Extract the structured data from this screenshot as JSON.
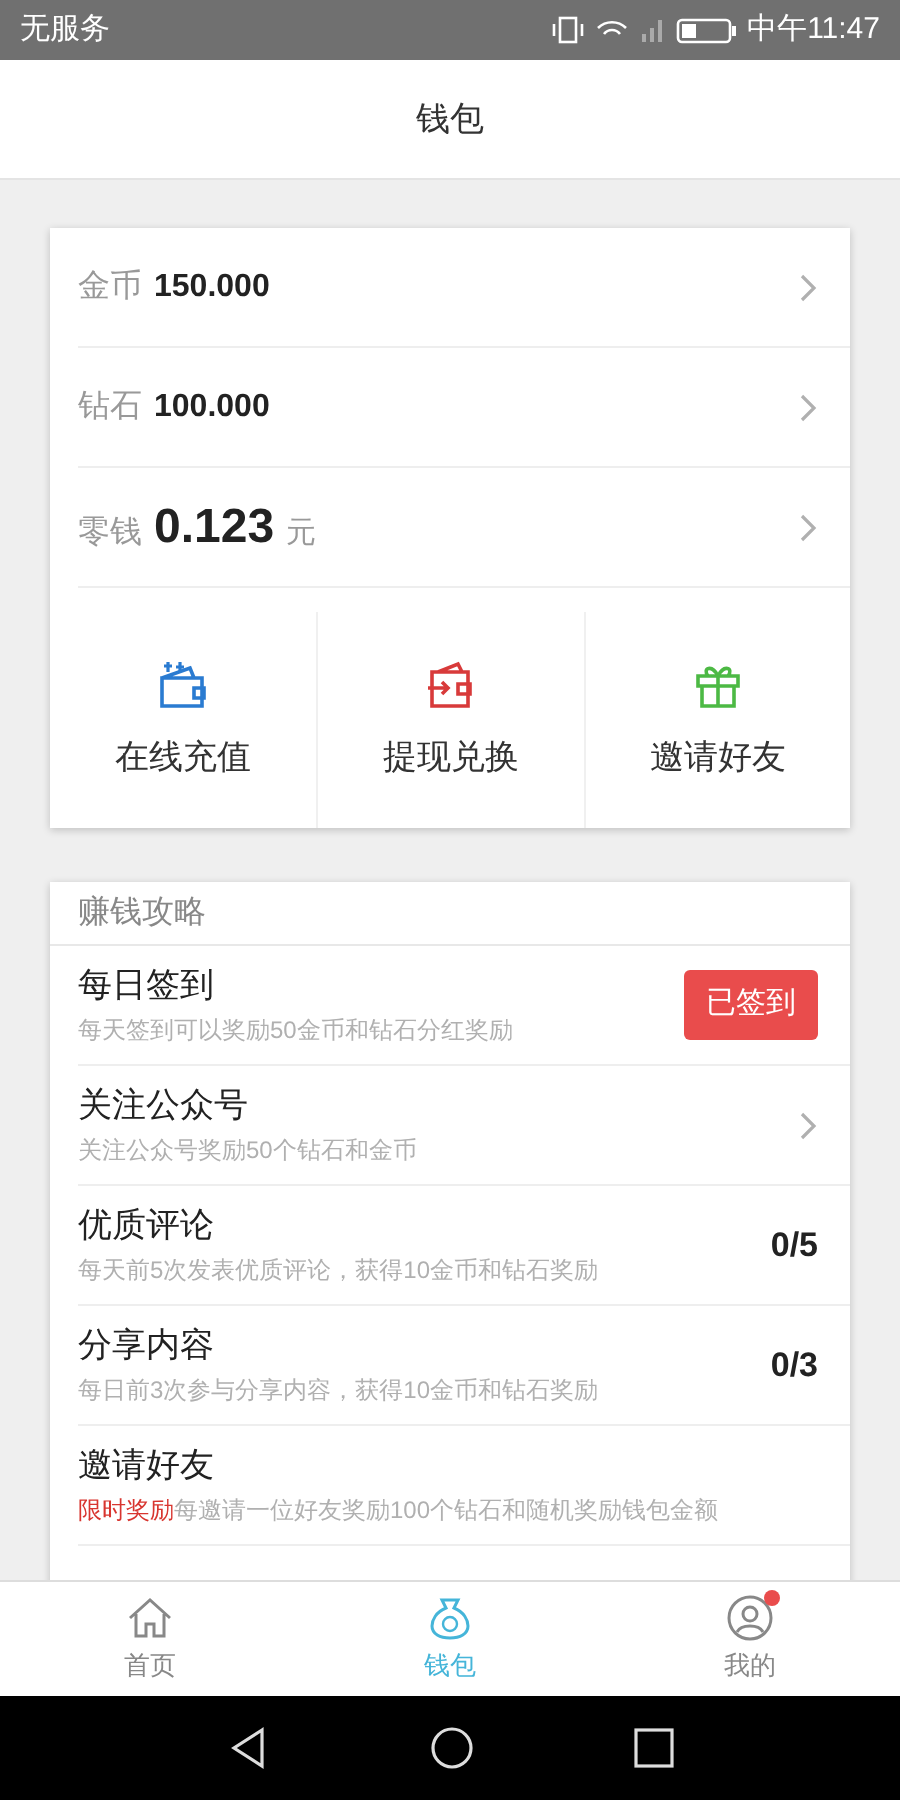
{
  "status_bar": {
    "carrier": "无服务",
    "time": "中午11:47"
  },
  "header": {
    "title": "钱包"
  },
  "balances": [
    {
      "label": "金币",
      "value": "150.000",
      "large": false
    },
    {
      "label": "钻石",
      "value": "100.000",
      "large": false
    },
    {
      "label": "零钱",
      "value": "0.123",
      "unit": "元",
      "large": true
    }
  ],
  "actions": [
    {
      "kind": "recharge",
      "label": "在线充值"
    },
    {
      "kind": "withdraw",
      "label": "提现兑换"
    },
    {
      "kind": "invite",
      "label": "邀请好友"
    }
  ],
  "tasks_section": {
    "title": "赚钱攻略",
    "items": [
      {
        "kind": "button",
        "title": "每日签到",
        "desc": "每天签到可以奖励50金币和钻石分红奖励",
        "action": "已签到"
      },
      {
        "kind": "chevron",
        "title": "关注公众号",
        "desc": "关注公众号奖励50个钻石和金币"
      },
      {
        "kind": "progress",
        "title": "优质评论",
        "desc": "每天前5次发表优质评论，获得10金币和钻石奖励",
        "progress": "0/5"
      },
      {
        "kind": "progress",
        "title": "分享内容",
        "desc": "每日前3次参与分享内容，获得10金币和钻石奖励",
        "progress": "0/3"
      },
      {
        "kind": "plain",
        "title": "邀请好友",
        "highlight": "限时奖励",
        "desc": "每邀请一位好友奖励100个钻石和随机奖励钱包金额"
      }
    ]
  },
  "tab_bar": [
    {
      "kind": "home",
      "label": "首页",
      "selected": false,
      "badge": false
    },
    {
      "kind": "wallet",
      "label": "钱包",
      "selected": true,
      "badge": false
    },
    {
      "kind": "profile",
      "label": "我的",
      "selected": false,
      "badge": true
    }
  ]
}
